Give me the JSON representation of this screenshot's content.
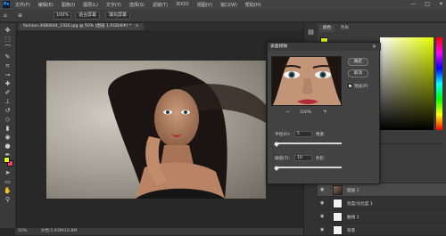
{
  "app": {
    "logo": "Ps"
  },
  "menubar": {
    "items": [
      "文件(F)",
      "编辑(E)",
      "图像(I)",
      "图层(L)",
      "文字(Y)",
      "选择(S)",
      "滤镜(T)",
      "3D(D)",
      "视图(V)",
      "窗口(W)",
      "帮助(H)"
    ],
    "window_controls": [
      "—",
      "□",
      "✕"
    ]
  },
  "options_bar": {
    "zoom": "100%",
    "fit_screen": "适合屏幕",
    "fill_screen": "填充屏幕"
  },
  "document": {
    "tab_title": "fashion-3080644_1920.jpg @ 50% (图层 1,RGB/8#) *",
    "tab_close": "×",
    "status": "50%",
    "status_doc": "文档:5.93M/16.8M"
  },
  "right_panel": {
    "tab_color": "颜色",
    "tab_swatches": "色板",
    "accent_color": "#e6ff00"
  },
  "dialog": {
    "title": "表面模糊",
    "close": "✕",
    "ok": "确定",
    "cancel": "取消",
    "preview_label": "预览(P)",
    "zoom_level": "100%",
    "zoom_out": "−",
    "zoom_in": "+",
    "radius_label": "半径(R):",
    "radius_value": "5",
    "radius_unit": "像素",
    "threshold_label": "阈值(T):",
    "threshold_value": "10",
    "threshold_unit": "色阶",
    "radius_fraction": 0.02,
    "threshold_fraction": 0.03
  },
  "layers": {
    "items": [
      {
        "name": "图层 1",
        "selected": true,
        "thumb": "photo"
      },
      {
        "name": "亮度/对比度 1",
        "selected": false,
        "thumb": "white"
      },
      {
        "name": "曲线 1",
        "selected": false,
        "thumb": "white"
      },
      {
        "name": "背景",
        "selected": false,
        "thumb": "white"
      }
    ]
  }
}
